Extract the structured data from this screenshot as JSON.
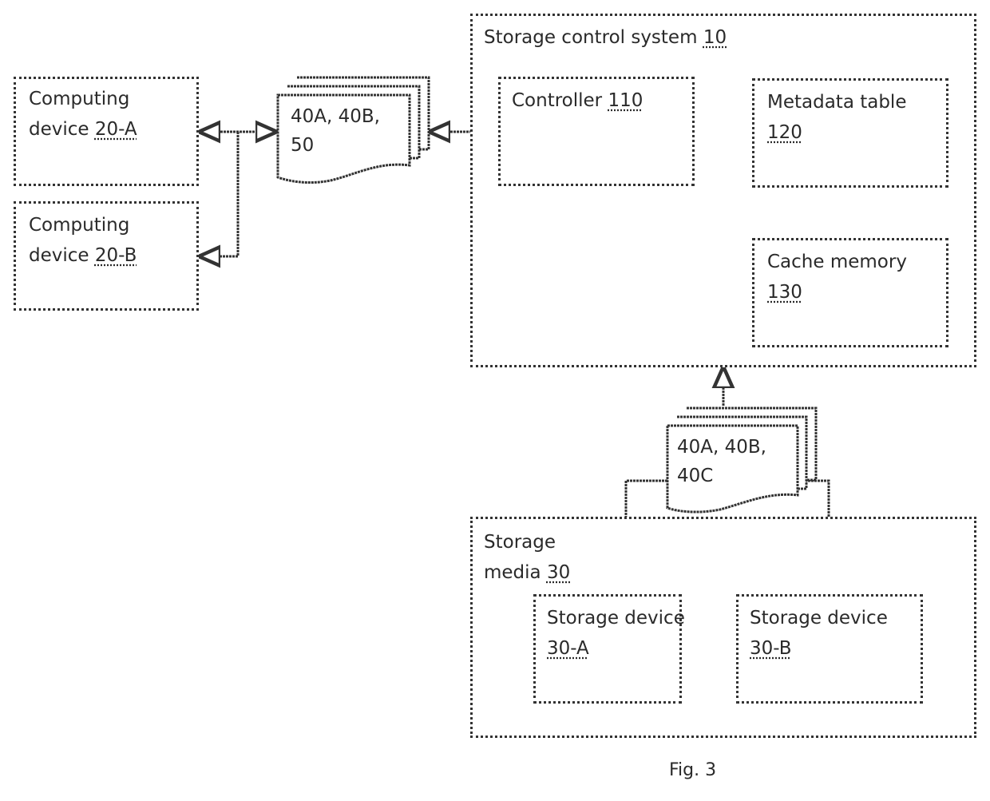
{
  "figure": {
    "caption": "Fig. 3"
  },
  "computing_device_a": {
    "line1": "Computing",
    "line2_prefix": "device ",
    "ref": "20-A"
  },
  "computing_device_b": {
    "line1": "Computing",
    "line2_prefix": "device ",
    "ref": "20-B"
  },
  "upper_document": {
    "line1": "40A, 40B,",
    "line2": "50"
  },
  "storage_control_system": {
    "prefix": "Storage control system ",
    "ref": "10",
    "controller": {
      "prefix": "Controller ",
      "ref": "110"
    },
    "metadata_table": {
      "line1": "Metadata table",
      "ref": "120"
    },
    "cache_memory": {
      "line1": "Cache memory",
      "ref": "130"
    }
  },
  "lower_document": {
    "line1": "40A, 40B,",
    "line2": "40C"
  },
  "storage_media": {
    "line1": "Storage",
    "line2_prefix": "media ",
    "ref": "30",
    "device_a": {
      "line1": "Storage device",
      "ref": "30-A"
    },
    "device_b": {
      "line1": "Storage device",
      "ref": "30-B"
    }
  }
}
